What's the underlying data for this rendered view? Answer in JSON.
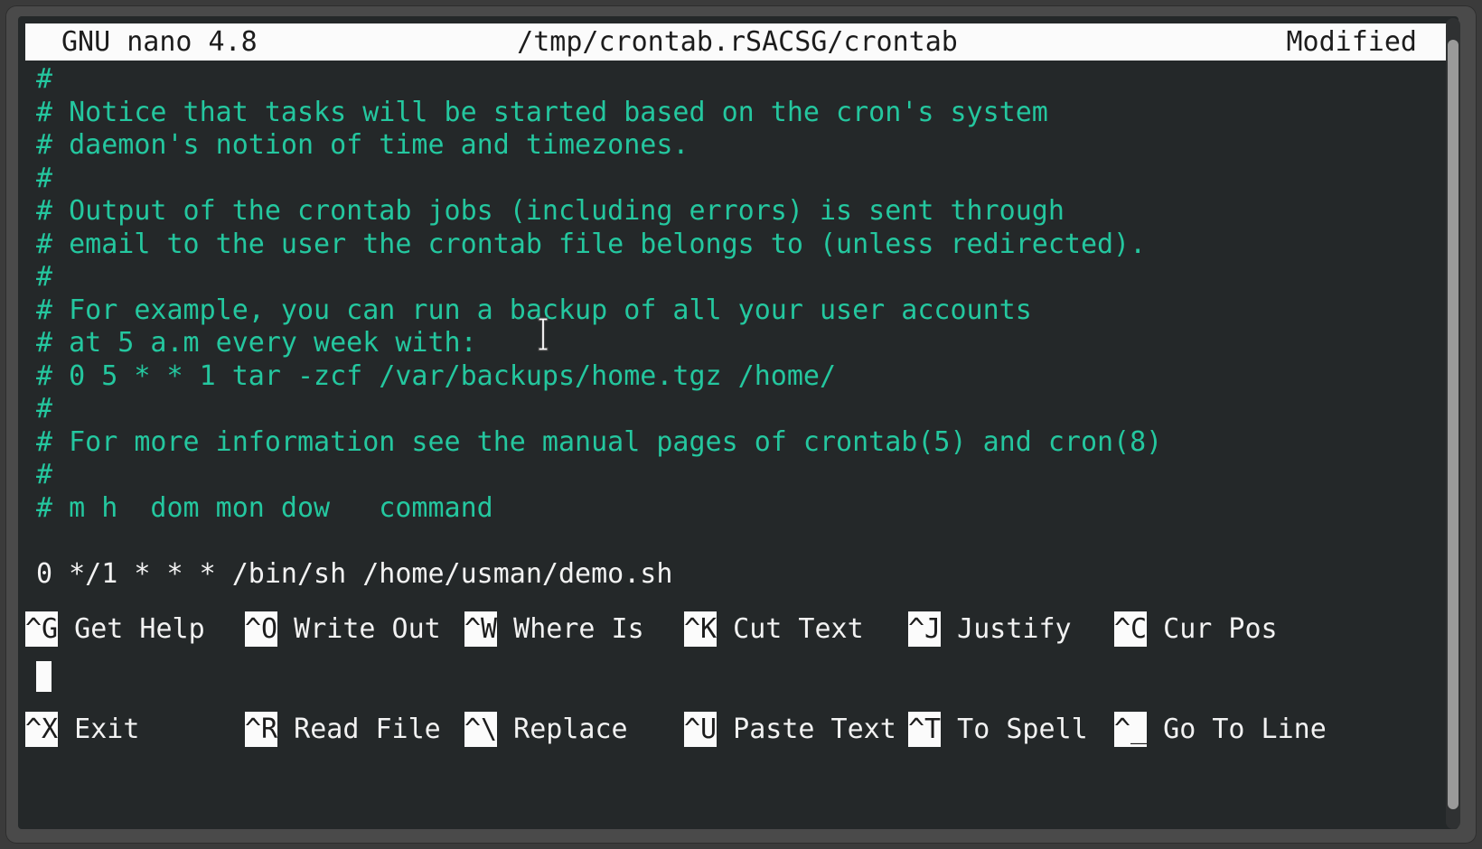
{
  "window": {
    "frame_color": "#4a4a4a",
    "terminal_bg": "#242829"
  },
  "titlebar": {
    "version": "GNU nano 4.8",
    "filename": "/tmp/crontab.rSACSG/crontab",
    "status": "Modified",
    "bg": "#fbfbfb",
    "fg": "#1c1c1c"
  },
  "editor": {
    "comment_color": "#24c79f",
    "command_color": "#f2f2f2",
    "lines": [
      {
        "text": "#",
        "kind": "comment"
      },
      {
        "text": "# Notice that tasks will be started based on the cron's system",
        "kind": "comment"
      },
      {
        "text": "# daemon's notion of time and timezones.",
        "kind": "comment"
      },
      {
        "text": "#",
        "kind": "comment"
      },
      {
        "text": "# Output of the crontab jobs (including errors) is sent through",
        "kind": "comment"
      },
      {
        "text": "# email to the user the crontab file belongs to (unless redirected).",
        "kind": "comment"
      },
      {
        "text": "#",
        "kind": "comment"
      },
      {
        "text": "# For example, you can run a backup of all your user accounts",
        "kind": "comment"
      },
      {
        "text": "# at 5 a.m every week with:",
        "kind": "comment"
      },
      {
        "text": "# 0 5 * * 1 tar -zcf /var/backups/home.tgz /home/",
        "kind": "comment"
      },
      {
        "text": "#",
        "kind": "comment"
      },
      {
        "text": "# For more information see the manual pages of crontab(5) and cron(8)",
        "kind": "comment"
      },
      {
        "text": "#",
        "kind": "comment"
      },
      {
        "text": "# m h  dom mon dow   command",
        "kind": "comment"
      },
      {
        "text": "",
        "kind": "blank"
      },
      {
        "text": "0 */1 * * * /bin/sh /home/usman/demo.sh",
        "kind": "cmd"
      },
      {
        "text": "",
        "kind": "blank"
      },
      {
        "text": "",
        "kind": "blank"
      },
      {
        "text": "",
        "kind": "blank"
      }
    ]
  },
  "shortcuts": {
    "row1": [
      {
        "key": "^G",
        "label": "Get Help"
      },
      {
        "key": "^O",
        "label": "Write Out"
      },
      {
        "key": "^W",
        "label": "Where Is"
      },
      {
        "key": "^K",
        "label": "Cut Text"
      },
      {
        "key": "^J",
        "label": "Justify"
      },
      {
        "key": "^C",
        "label": "Cur Pos"
      }
    ],
    "row2": [
      {
        "key": "^X",
        "label": "Exit"
      },
      {
        "key": "^R",
        "label": "Read File"
      },
      {
        "key": "^\\",
        "label": "Replace"
      },
      {
        "key": "^U",
        "label": "Paste Text"
      },
      {
        "key": "^T",
        "label": "To Spell"
      },
      {
        "key": "^_",
        "label": "Go To Line"
      }
    ]
  },
  "cursor": {
    "block_cursor_color": "#fbfbfb"
  },
  "scrollbar": {
    "track_color": "#2f3132",
    "thumb_color": "#9a9a9a"
  }
}
